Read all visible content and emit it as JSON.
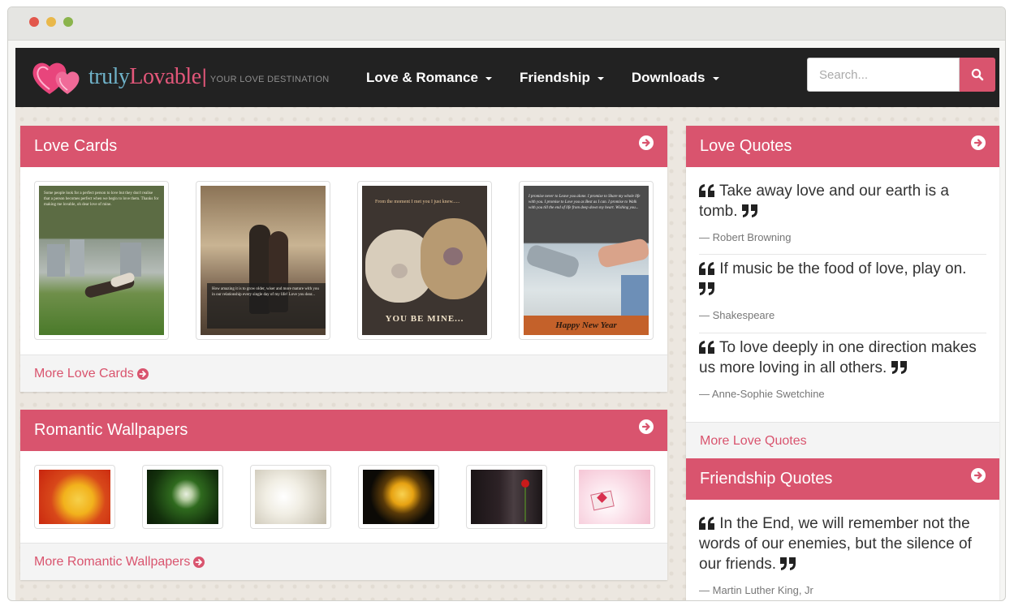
{
  "logo": {
    "brand_part1": "truly",
    "brand_part2": "Lovable",
    "separator": "|",
    "tagline": "YOUR LOVE DESTINATION"
  },
  "nav": {
    "items": [
      {
        "label": "Love & Romance"
      },
      {
        "label": "Friendship"
      },
      {
        "label": "Downloads"
      }
    ]
  },
  "search": {
    "placeholder": "Search..."
  },
  "love_cards": {
    "title": "Love Cards",
    "more_label": "More Love Cards",
    "cards": [
      {
        "text": "Some people look for a perfect person to love but they don't realise that a person becomes perfect when we begin to love them. Thanks for making me lovable, oh dear love of mine."
      },
      {
        "text": "How amazing it is to grow older, wiser and more mature with you in our relationship every single day of my life! Love you dear..."
      },
      {
        "text_top": "From the moment I met you I just knew......",
        "text_bottom": "YOU BE MINE..."
      },
      {
        "text": "I promise never to Leave you alone. I promise to Share my whole life with you. I promise to Love you as Best as I can. I promise to Walk with you till the end of life from deep down my heart. Wishing you...",
        "banner": "Happy New Year"
      }
    ]
  },
  "wallpapers": {
    "title": "Romantic Wallpapers",
    "more_label": "More Romantic Wallpapers"
  },
  "love_quotes": {
    "title": "Love Quotes",
    "more_label": "More Love Quotes",
    "quotes": [
      {
        "text": "Take away love and our earth is a tomb.",
        "author": "— Robert Browning"
      },
      {
        "text": "If music be the food of love, play on.",
        "author": "— Shakespeare"
      },
      {
        "text": "To love deeply in one direction makes us more loving in all others.",
        "author": "— Anne-Sophie Swetchine"
      }
    ]
  },
  "friendship_quotes": {
    "title": "Friendship Quotes",
    "quotes": [
      {
        "text": "In the End, we will remember not the words of our enemies, but the silence of our friends.",
        "author": "— Martin Luther King, Jr"
      }
    ]
  },
  "colors": {
    "accent": "#d9546e",
    "navbar": "#222222",
    "background": "#ece7e0",
    "text": "#333333"
  },
  "icons": {
    "search": "search-icon",
    "panel_arrow": "circle-arrow-right-icon",
    "quote": "quote-icon"
  }
}
